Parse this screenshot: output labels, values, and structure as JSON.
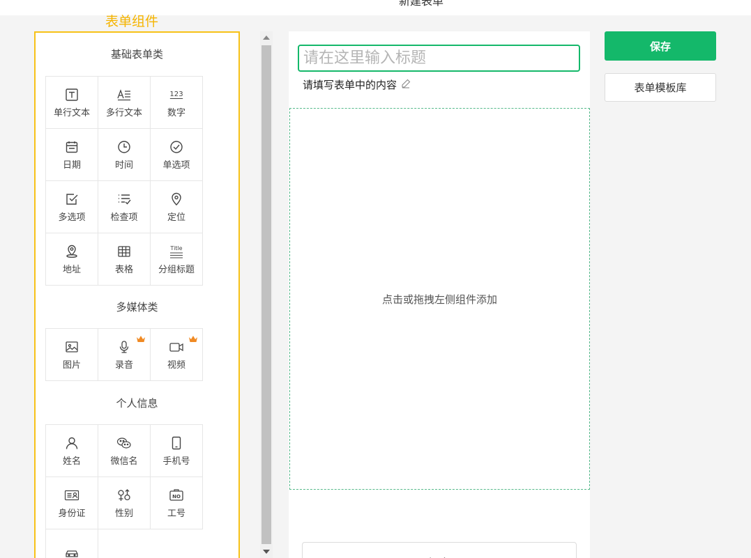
{
  "header": {
    "title": "新建表单"
  },
  "panel": {
    "label": "表单组件",
    "sections": [
      {
        "title": "基础表单类",
        "items": [
          {
            "label": "单行文本",
            "icon": "single-line-text-icon"
          },
          {
            "label": "多行文本",
            "icon": "multi-line-text-icon"
          },
          {
            "label": "数字",
            "icon": "number-icon"
          },
          {
            "label": "日期",
            "icon": "calendar-icon"
          },
          {
            "label": "时间",
            "icon": "clock-icon"
          },
          {
            "label": "单选项",
            "icon": "check-circle-icon"
          },
          {
            "label": "多选项",
            "icon": "checkbox-icon"
          },
          {
            "label": "检查项",
            "icon": "checklist-icon"
          },
          {
            "label": "定位",
            "icon": "location-pin-icon"
          },
          {
            "label": "地址",
            "icon": "address-pin-icon"
          },
          {
            "label": "表格",
            "icon": "table-icon"
          },
          {
            "label": "分组标题",
            "icon": "title-icon",
            "icon_text": "Title"
          }
        ]
      },
      {
        "title": "多媒体类",
        "items": [
          {
            "label": "图片",
            "icon": "image-icon"
          },
          {
            "label": "录音",
            "icon": "microphone-icon",
            "premium": true
          },
          {
            "label": "视频",
            "icon": "video-icon",
            "premium": true
          }
        ]
      },
      {
        "title": "个人信息",
        "items": [
          {
            "label": "姓名",
            "icon": "user-icon"
          },
          {
            "label": "微信名",
            "icon": "wechat-icon"
          },
          {
            "label": "手机号",
            "icon": "phone-icon"
          },
          {
            "label": "身份证",
            "icon": "id-card-icon"
          },
          {
            "label": "性别",
            "icon": "gender-icon"
          },
          {
            "label": "工号",
            "icon": "badge-no-icon",
            "icon_text": "NO"
          },
          {
            "label": "",
            "icon": "car-icon"
          }
        ]
      }
    ]
  },
  "canvas": {
    "title_placeholder": "请在这里输入标题",
    "description": "请填写表单中的内容",
    "dropzone_hint": "点击或拖拽左侧组件添加",
    "submit_label": "提交"
  },
  "actions": {
    "save_label": "保存",
    "template_label": "表单模板库"
  },
  "colors": {
    "accent": "#14b86a",
    "highlight": "#f7c217",
    "label": "#f5b400",
    "crown": "#f08a24"
  }
}
